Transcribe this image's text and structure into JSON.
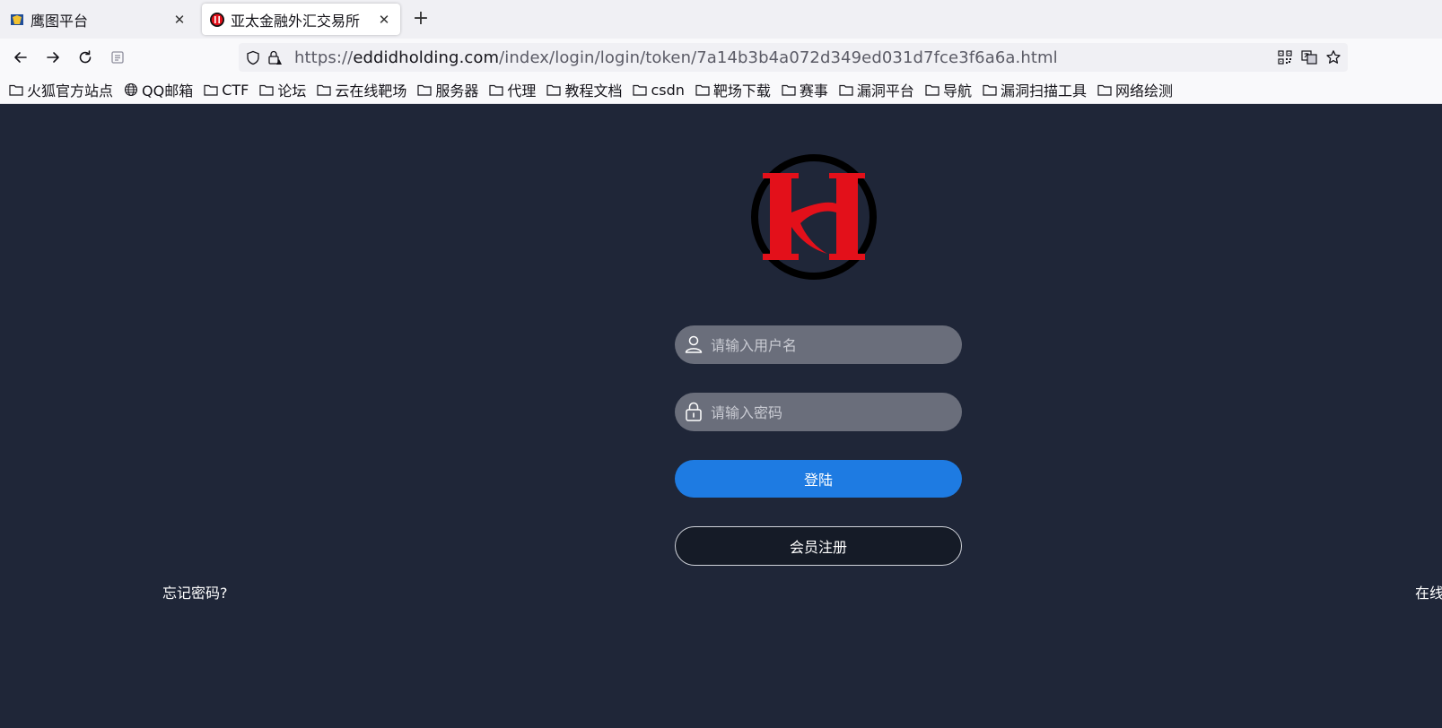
{
  "browser": {
    "tabs": [
      {
        "label": "鹰图平台",
        "active": false
      },
      {
        "label": "亚太金融外汇交易所",
        "active": true
      }
    ],
    "address": {
      "scheme": "https://",
      "host": "eddidholding.com",
      "path": "/index/login/login/token/7a14b3b4a072d349ed031d7fce3f6a6a.html"
    },
    "bookmarks": [
      {
        "label": "火狐官方站点",
        "icon": "folder-icon"
      },
      {
        "label": "QQ邮箱",
        "icon": "globe-icon"
      },
      {
        "label": "CTF",
        "icon": "folder-icon"
      },
      {
        "label": "论坛",
        "icon": "folder-icon"
      },
      {
        "label": "云在线靶场",
        "icon": "folder-icon"
      },
      {
        "label": "服务器",
        "icon": "folder-icon"
      },
      {
        "label": "代理",
        "icon": "folder-icon"
      },
      {
        "label": "教程文档",
        "icon": "folder-icon"
      },
      {
        "label": "csdn",
        "icon": "folder-icon"
      },
      {
        "label": "靶场下载",
        "icon": "folder-icon"
      },
      {
        "label": "赛事",
        "icon": "folder-icon"
      },
      {
        "label": "漏洞平台",
        "icon": "folder-icon"
      },
      {
        "label": "导航",
        "icon": "folder-icon"
      },
      {
        "label": "漏洞扫描工具",
        "icon": "folder-icon"
      },
      {
        "label": "网络绘测",
        "icon": "folder-icon"
      }
    ]
  },
  "login": {
    "username_placeholder": "请输入用户名",
    "password_placeholder": "请输入密码",
    "login_button": "登陆",
    "register_button": "会员注册",
    "forgot_password": "忘记密码?",
    "online_link": "在线"
  },
  "colors": {
    "page_background": "#1f2638",
    "input_background": "#6a6e7b",
    "login_button": "#1e7be2",
    "logo_red": "#e3101a"
  }
}
